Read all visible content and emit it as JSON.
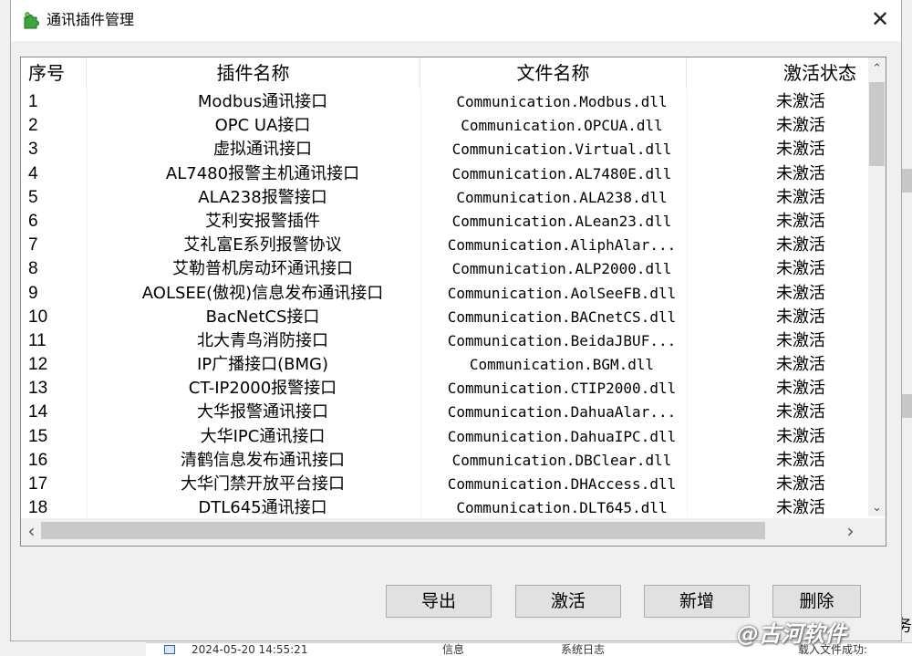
{
  "dialog": {
    "title": "通讯插件管理",
    "close_glyph": "✕"
  },
  "table": {
    "columns": [
      "序号",
      "插件名称",
      "文件名称",
      "激活状态"
    ],
    "rows": [
      {
        "idx": "1",
        "name": "Modbus通讯接口",
        "file": "Communication.Modbus.dll",
        "status": "未激活"
      },
      {
        "idx": "2",
        "name": "OPC UA接口",
        "file": "Communication.OPCUA.dll",
        "status": "未激活"
      },
      {
        "idx": "3",
        "name": "虚拟通讯接口",
        "file": "Communication.Virtual.dll",
        "status": "未激活"
      },
      {
        "idx": "4",
        "name": "AL7480报警主机通讯接口",
        "file": "Communication.AL7480E.dll",
        "status": "未激活"
      },
      {
        "idx": "5",
        "name": "ALA238报警接口",
        "file": "Communication.ALA238.dll",
        "status": "未激活"
      },
      {
        "idx": "6",
        "name": "艾利安报警插件",
        "file": "Communication.ALean23.dll",
        "status": "未激活"
      },
      {
        "idx": "7",
        "name": "艾礼富E系列报警协议",
        "file": "Communication.AliphAlar...",
        "status": "未激活"
      },
      {
        "idx": "8",
        "name": "艾勒普机房动环通讯接口",
        "file": "Communication.ALP2000.dll",
        "status": "未激活"
      },
      {
        "idx": "9",
        "name": "AOLSEE(傲视)信息发布通讯接口",
        "file": "Communication.AolSeeFB.dll",
        "status": "未激活"
      },
      {
        "idx": "10",
        "name": "BacNetCS接口",
        "file": "Communication.BACnetCS.dll",
        "status": "未激活"
      },
      {
        "idx": "11",
        "name": "北大青鸟消防接口",
        "file": "Communication.BeidaJBUF...",
        "status": "未激活"
      },
      {
        "idx": "12",
        "name": "IP广播接口(BMG)",
        "file": "Communication.BGM.dll",
        "status": "未激活"
      },
      {
        "idx": "13",
        "name": "CT-IP2000报警接口",
        "file": "Communication.CTIP2000.dll",
        "status": "未激活"
      },
      {
        "idx": "14",
        "name": "大华报警通讯接口",
        "file": "Communication.DahuaAlar...",
        "status": "未激活"
      },
      {
        "idx": "15",
        "name": "大华IPC通讯接口",
        "file": "Communication.DahuaIPC.dll",
        "status": "未激活"
      },
      {
        "idx": "16",
        "name": "清鹤信息发布通讯接口",
        "file": "Communication.DBClear.dll",
        "status": "未激活"
      },
      {
        "idx": "17",
        "name": "大华门禁开放平台接口",
        "file": "Communication.DHAccess.dll",
        "status": "未激活"
      },
      {
        "idx": "18",
        "name": "DTL645通讯接口",
        "file": "Communication.DLT645.dll",
        "status": "未激活"
      }
    ]
  },
  "scroll": {
    "up": "⌃",
    "down": "⌄",
    "left": "‹",
    "right": "›"
  },
  "buttons": {
    "export": "导出",
    "activate": "激活",
    "add": "新增",
    "delete": "删除"
  },
  "background": {
    "timestamp": "2024-05-20 14:55:21",
    "level": "信息",
    "category": "系统日志",
    "message": "载入文件成功:",
    "right_edge_text": "务"
  },
  "watermark": "@古河软件"
}
